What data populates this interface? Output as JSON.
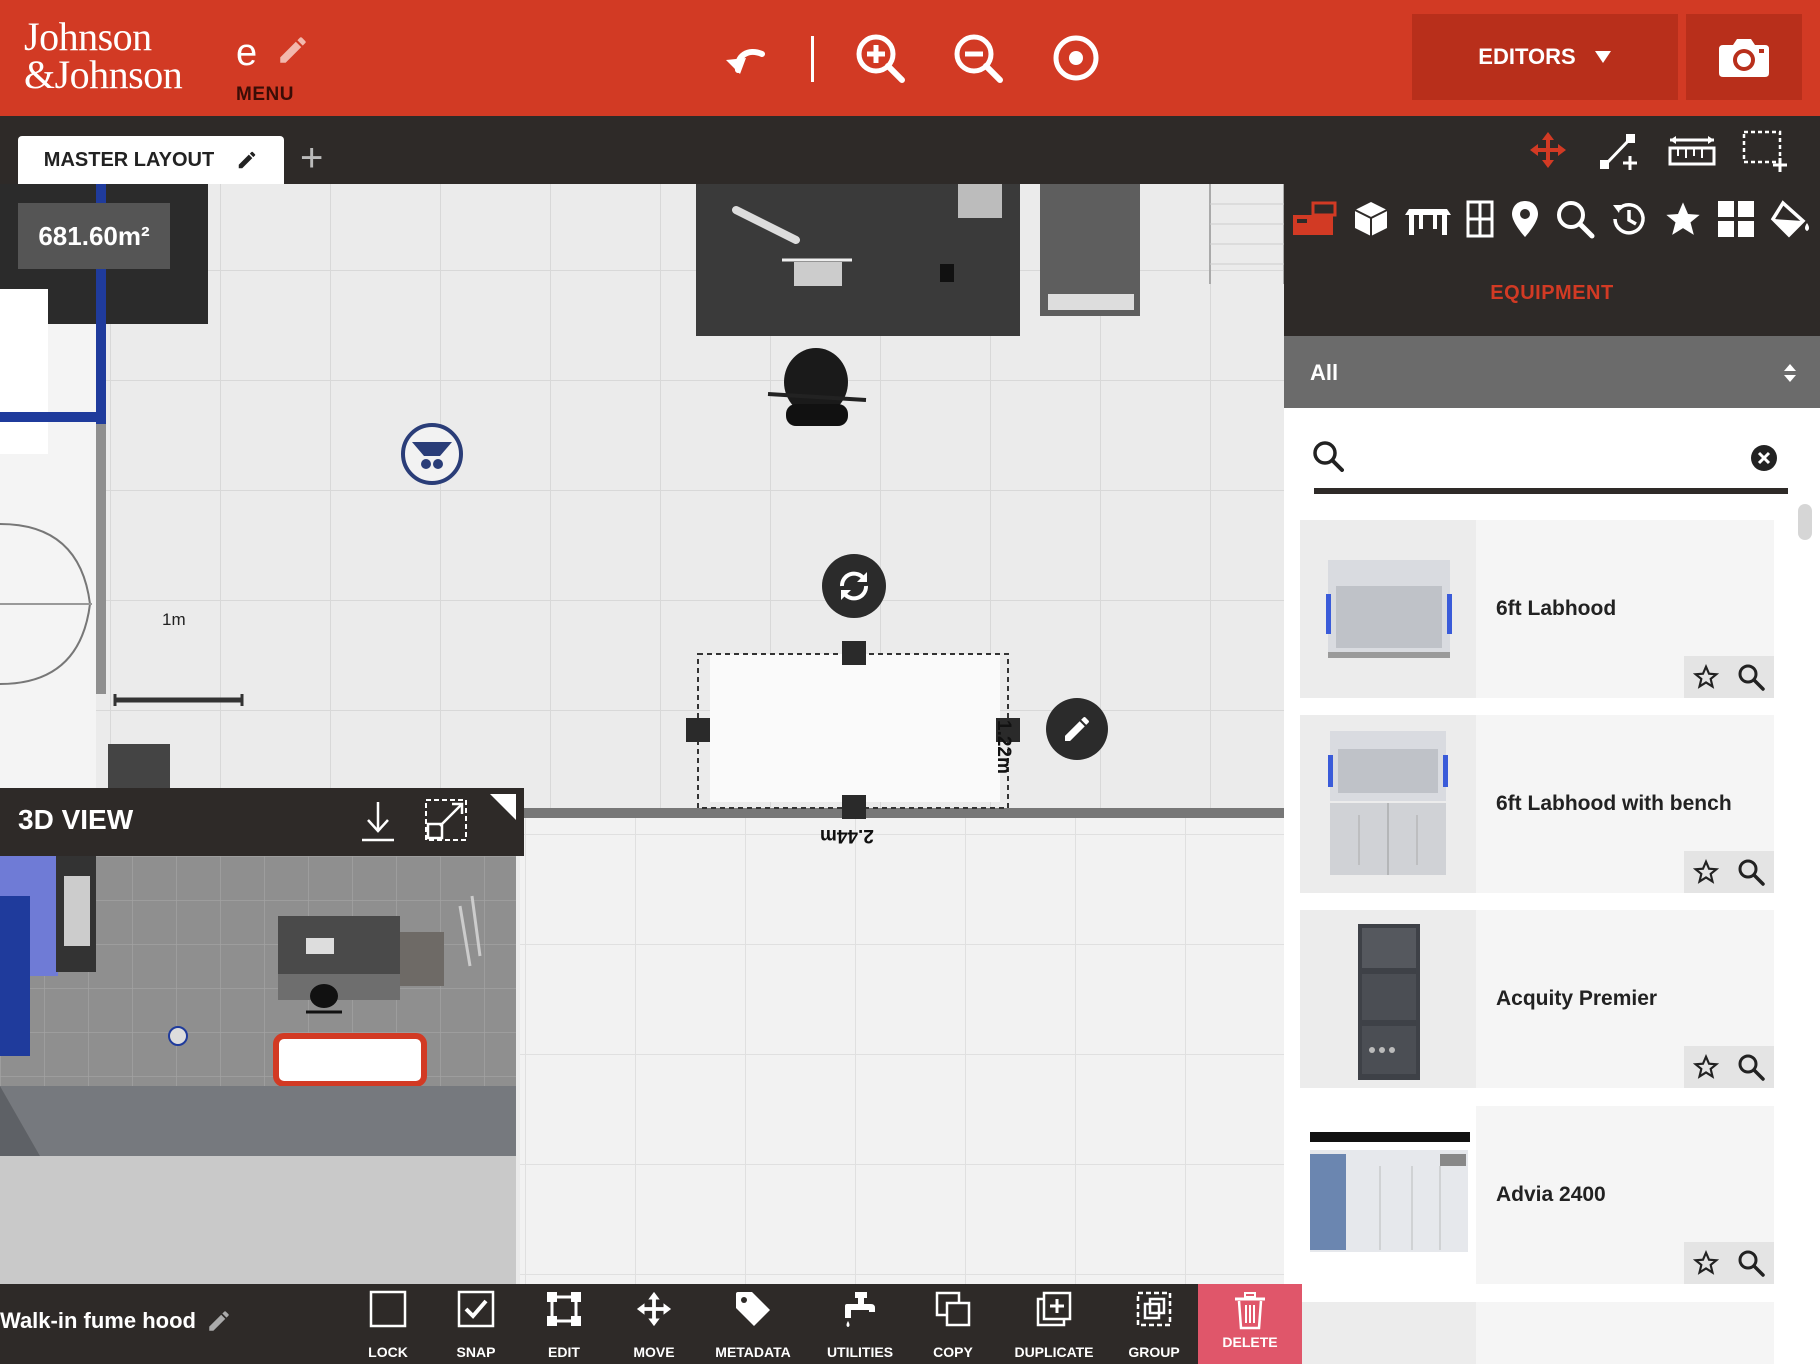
{
  "brand": {
    "line1": "Johnson",
    "line2": "&Johnson"
  },
  "menu": {
    "initial": "e",
    "label": "MENU"
  },
  "toolbar": {
    "editors_label": "EDITORS"
  },
  "tabs": {
    "master_label": "MASTER LAYOUT",
    "add_label": "+"
  },
  "canvas": {
    "area": "681.60m²",
    "scale_label": "1m",
    "selection": {
      "width_label": "2.44m",
      "height_label": "1.22m"
    }
  },
  "panel": {
    "category_label": "EQUIPMENT",
    "filter_value": "All",
    "search_placeholder": "",
    "items": [
      {
        "name": "6ft Labhood"
      },
      {
        "name": "6ft Labhood with bench"
      },
      {
        "name": "Acquity Premier"
      },
      {
        "name": "Advia 2400"
      }
    ]
  },
  "view3d": {
    "title": "3D VIEW"
  },
  "selected_object": {
    "name": "Walk-in fume hood"
  },
  "bottom_actions": {
    "lock": "LOCK",
    "snap": "SNAP",
    "edit": "EDIT",
    "move": "MOVE",
    "metadata": "METADATA",
    "utilities": "UTILITIES",
    "copy": "COPY",
    "duplicate": "DUPLICATE",
    "group": "GROUP",
    "delete": "DELETE"
  },
  "colors": {
    "brand_red": "#d23a24",
    "dark": "#2e2a28",
    "delete_pink": "#e0566a",
    "wall_blue": "#1f3b9c"
  }
}
